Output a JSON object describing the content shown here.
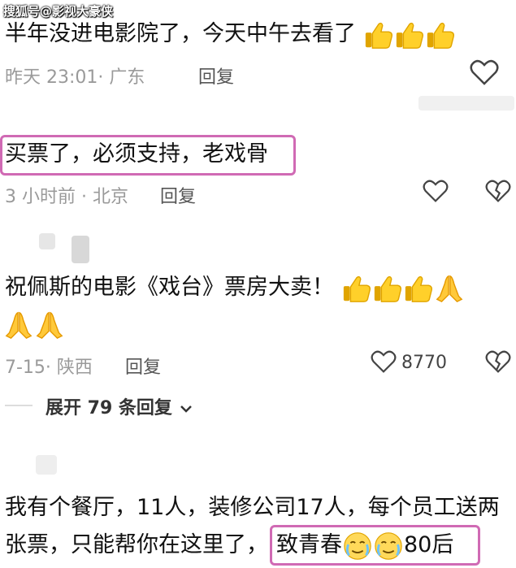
{
  "watermark": "搜狐号@影视大豪侠",
  "comment1": {
    "text": "半年没进电影院了，今天中午去看了",
    "meta": "昨天 23:01· 广东",
    "reply_label": "回复",
    "icons": [
      "thumbs-up-emoji",
      "thumbs-up-emoji",
      "thumbs-up-emoji"
    ]
  },
  "comment2": {
    "text": "买票了，必须支持，老戏骨",
    "meta": "3 小时前 · 北京",
    "reply_label": "回复"
  },
  "comment3": {
    "text": "祝佩斯的电影《戏台》票房大卖！",
    "meta": "7-15· 陕西",
    "reply_label": "回复",
    "like_count": "8770",
    "expand_label": "展开 79 条回复",
    "icons": [
      "thumbs-up-emoji",
      "thumbs-up-emoji",
      "thumbs-up-emoji",
      "praying-hands-emoji",
      "praying-hands-emoji",
      "praying-hands-emoji"
    ]
  },
  "comment4": {
    "text_line1": "我有个餐厅，11人，装修公司17人，每个员工送两",
    "text_line2": "张票，只能帮你在这里了，",
    "highlight_text_a": "致青春",
    "highlight_text_b": "80后",
    "icons": [
      "teary-smile-emoji",
      "teary-smile-emoji"
    ]
  },
  "colors": {
    "highlight_border": "#d06ab4",
    "meta_gray": "#9a9a9a"
  }
}
